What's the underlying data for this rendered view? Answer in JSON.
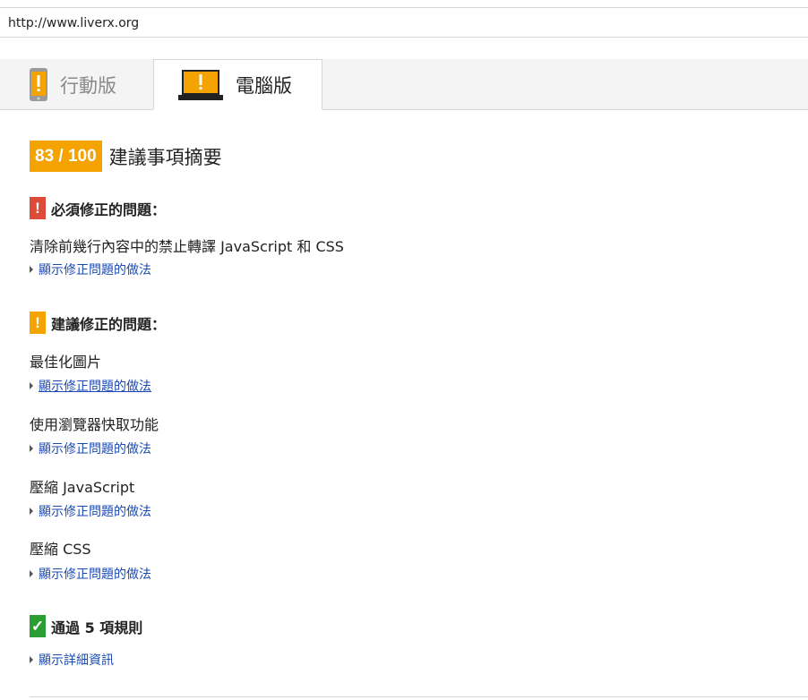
{
  "url_bar": {
    "url": "http://www.liverx.org"
  },
  "tabs": [
    {
      "label": "行動版",
      "icon": "mobile-phone-warning-icon",
      "active": false
    },
    {
      "label": "電腦版",
      "icon": "laptop-warning-icon",
      "active": true
    }
  ],
  "summary": {
    "score": "83 / 100",
    "title": "建議事項摘要",
    "score_color": "#f4a300"
  },
  "must_fix": {
    "icon": "!",
    "icon_color": "#dd4b39",
    "title": "必須修正的問題：",
    "items": [
      {
        "title": "清除前幾行內容中的禁止轉譯 JavaScript 和 CSS",
        "link": "顯示修正問題的做法"
      }
    ]
  },
  "should_fix": {
    "icon": "!",
    "icon_color": "#f4a300",
    "title": "建議修正的問題：",
    "items": [
      {
        "title": "最佳化圖片",
        "link": "顯示修正問題的做法"
      },
      {
        "title": "使用瀏覽器快取功能",
        "link": "顯示修正問題的做法"
      },
      {
        "title": "壓縮 JavaScript",
        "link": "顯示修正問題的做法"
      },
      {
        "title": "壓縮 CSS",
        "link": "顯示修正問題的做法"
      }
    ]
  },
  "passed": {
    "icon": "✓",
    "icon_color": "#2a9d33",
    "title": "通過 5 項規則",
    "link": "顯示詳細資訊"
  }
}
